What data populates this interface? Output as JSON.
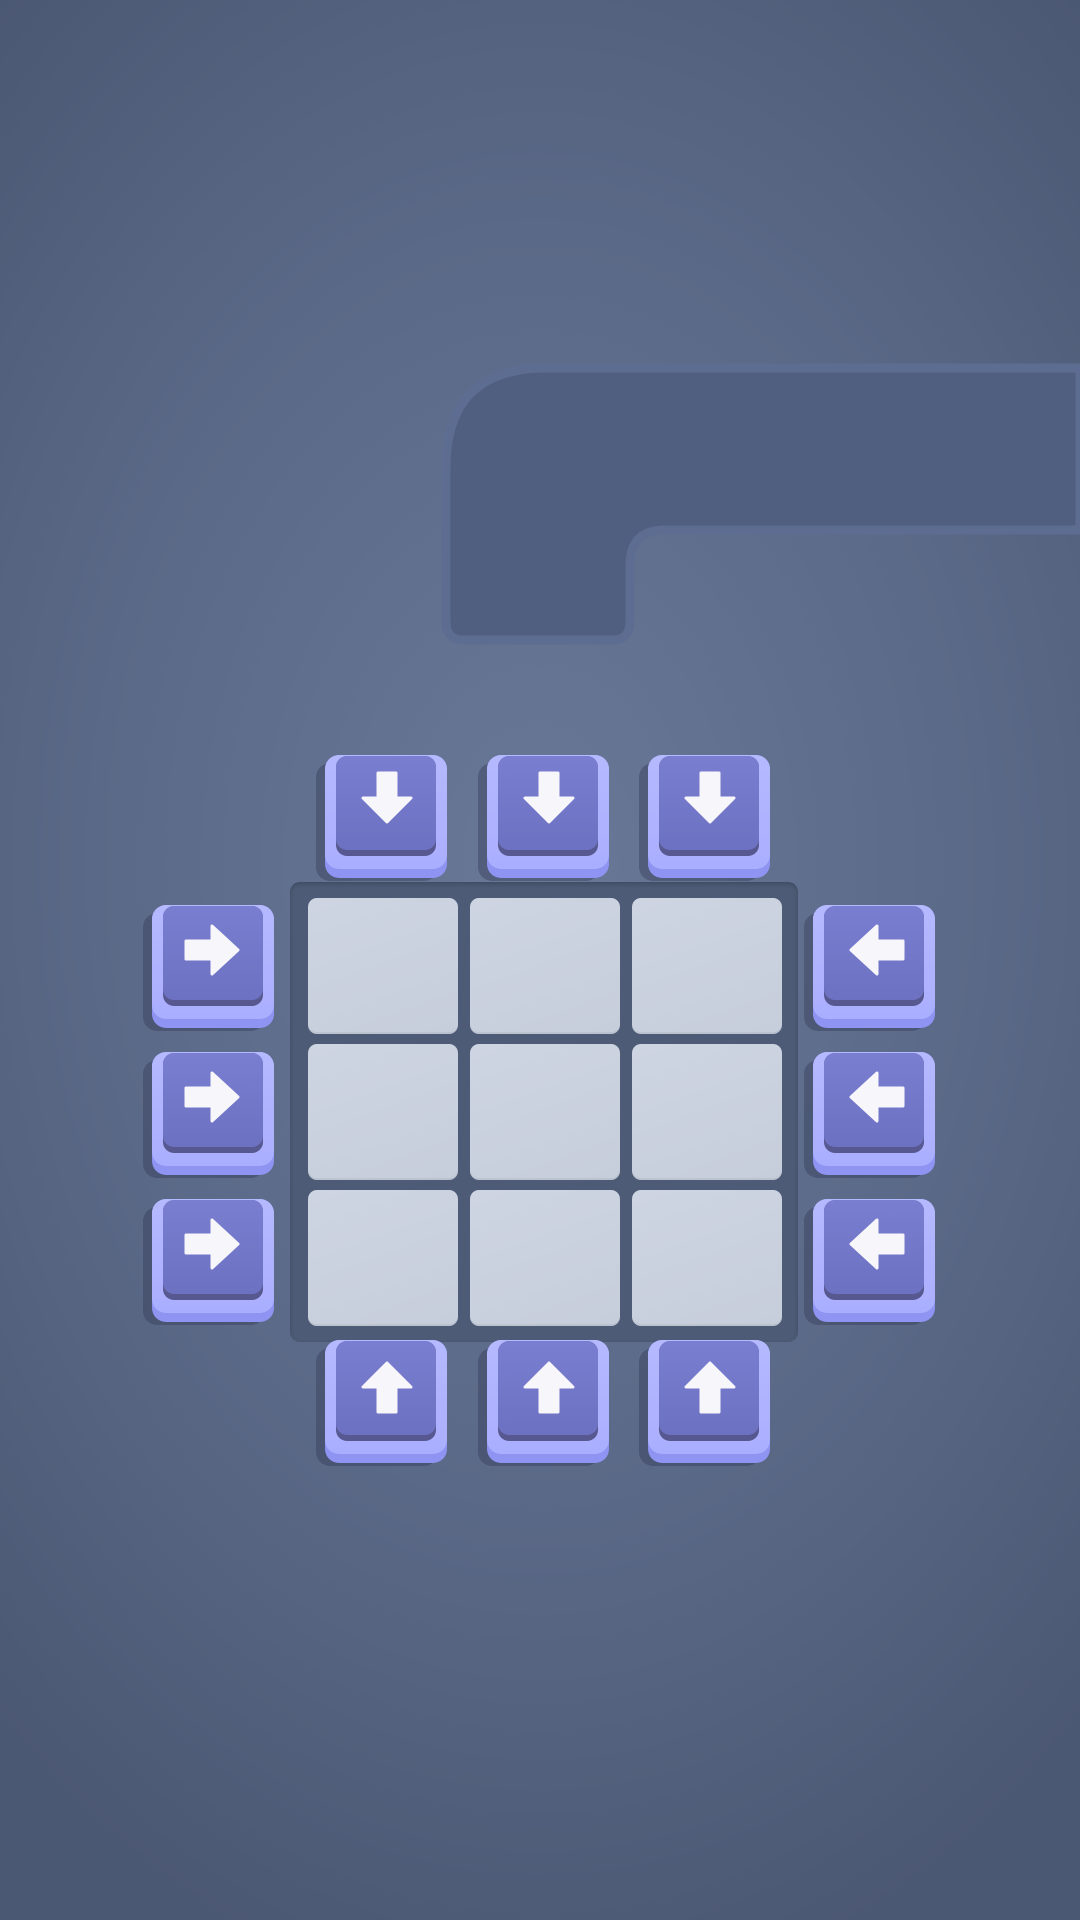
{
  "colors": {
    "background": "#5b6988",
    "board": "#4d5b76",
    "cell": "#c9d0de",
    "key_rim": "#aaaeff",
    "key_cap": "#7073c4",
    "arrow": "#f7f7fb"
  },
  "board": {
    "rows": 3,
    "cols": 3,
    "cells": [
      "",
      "",
      "",
      "",
      "",
      "",
      "",
      "",
      ""
    ]
  },
  "keys": {
    "top": [
      {
        "icon": "arrow-down-icon",
        "direction": "down",
        "column": 1
      },
      {
        "icon": "arrow-down-icon",
        "direction": "down",
        "column": 2
      },
      {
        "icon": "arrow-down-icon",
        "direction": "down",
        "column": 3
      }
    ],
    "bottom": [
      {
        "icon": "arrow-up-icon",
        "direction": "up",
        "column": 1
      },
      {
        "icon": "arrow-up-icon",
        "direction": "up",
        "column": 2
      },
      {
        "icon": "arrow-up-icon",
        "direction": "up",
        "column": 3
      }
    ],
    "left": [
      {
        "icon": "arrow-right-icon",
        "direction": "right",
        "row": 1
      },
      {
        "icon": "arrow-right-icon",
        "direction": "right",
        "row": 2
      },
      {
        "icon": "arrow-right-icon",
        "direction": "right",
        "row": 3
      }
    ],
    "right": [
      {
        "icon": "arrow-left-icon",
        "direction": "left",
        "row": 1
      },
      {
        "icon": "arrow-left-icon",
        "direction": "left",
        "row": 2
      },
      {
        "icon": "arrow-left-icon",
        "direction": "left",
        "row": 3
      }
    ]
  }
}
